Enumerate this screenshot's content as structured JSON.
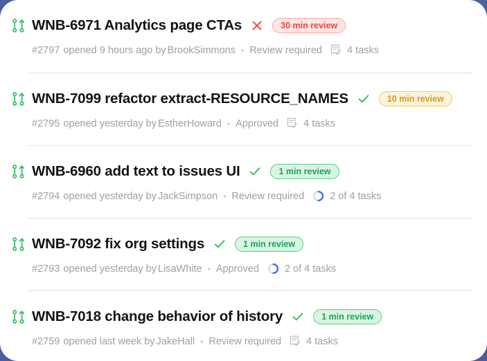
{
  "theme": {
    "page_background": "#4b5f9e",
    "card_background": "#ffffff",
    "title_color": "#111315",
    "meta_color": "#9aa1a9",
    "separator_color": "#dde3ea",
    "pr_icon_color": "#2cbf5c",
    "check_color": "#2cbf5c",
    "x_color": "#f0574a",
    "progress_color": "#3b6ef0",
    "progress_track_color": "#d8dce3",
    "badge_red": {
      "bg": "#ffe5e3",
      "border": "#f9a8a1",
      "text": "#e8483a"
    },
    "badge_amber": {
      "bg": "#fdf3d9",
      "border": "#f0c96a",
      "text": "#d99a13"
    },
    "badge_green": {
      "bg": "#d8f5e2",
      "border": "#5cc98a",
      "text": "#1ea35a"
    }
  },
  "pull_requests": [
    {
      "pr_icon": "git-pull-request-icon",
      "title": "WNB-6971 Analytics page CTAs",
      "status_icon": "x-icon",
      "status_icon_kind": "x",
      "badge": "30 min review",
      "badge_kind": "red",
      "number": "#2797",
      "opened": "opened 9 hours ago by",
      "author": "BrookSimmons",
      "separator_dot": "•",
      "review_state": "Review required",
      "tasks_icon": "tasks-checklist-icon",
      "tasks_icon_kind": "checklist",
      "tasks": "4 tasks"
    },
    {
      "pr_icon": "git-pull-request-icon",
      "title": "WNB-7099 refactor extract-RESOURCE_NAMES",
      "status_icon": "check-icon",
      "status_icon_kind": "check",
      "badge": "10 min review",
      "badge_kind": "amber",
      "number": "#2795",
      "opened": "opened yesterday by",
      "author": "EstherHoward",
      "separator_dot": "•",
      "review_state": "Approved",
      "tasks_icon": "tasks-checklist-icon",
      "tasks_icon_kind": "checklist",
      "tasks": "4 tasks"
    },
    {
      "pr_icon": "git-pull-request-icon",
      "title": "WNB-6960 add text to issues UI",
      "status_icon": "check-icon",
      "status_icon_kind": "check",
      "badge": "1 min review",
      "badge_kind": "green",
      "number": "#2794",
      "opened": "opened yesterday by",
      "author": "JackSimpson",
      "separator_dot": "•",
      "review_state": "Review required",
      "tasks_icon": "tasks-progress-icon",
      "tasks_icon_kind": "progress",
      "tasks": "2 of 4 tasks"
    },
    {
      "pr_icon": "git-pull-request-icon",
      "title": "WNB-7092 fix org settings",
      "status_icon": "check-icon",
      "status_icon_kind": "check",
      "badge": "1 min review",
      "badge_kind": "green",
      "number": "#2793",
      "opened": "opened yesterday by",
      "author": "LisaWhite",
      "separator_dot": "•",
      "review_state": "Approved",
      "tasks_icon": "tasks-progress-icon",
      "tasks_icon_kind": "progress",
      "tasks": "2 of 4 tasks"
    },
    {
      "pr_icon": "git-pull-request-icon",
      "title": "WNB-7018 change behavior of history",
      "status_icon": "check-icon",
      "status_icon_kind": "check",
      "badge": "1 min review",
      "badge_kind": "green",
      "number": "#2759",
      "opened": "opened last week by",
      "author": "JakeHall",
      "separator_dot": "•",
      "review_state": "Review required",
      "tasks_icon": "tasks-checklist-icon",
      "tasks_icon_kind": "checklist",
      "tasks": "4 tasks"
    }
  ]
}
